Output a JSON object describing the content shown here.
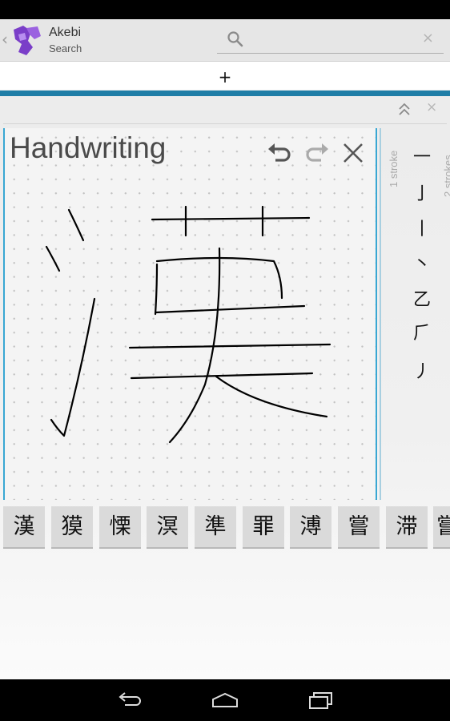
{
  "app": {
    "title": "Akebi",
    "subtitle": "Search"
  },
  "search": {
    "value": "",
    "clear_glyph": "×"
  },
  "tabs": {
    "add_label": "+"
  },
  "panel": {
    "close_glyph": "×"
  },
  "handwriting": {
    "title": "Handwriting"
  },
  "stroke_panel": {
    "groups": [
      {
        "label": "1 stroke"
      },
      {
        "label": "2 strokes"
      }
    ],
    "radicals": [
      "一",
      "亅",
      "丨",
      "丶",
      "乙",
      "⺁",
      "丿"
    ]
  },
  "candidates": [
    "漢",
    "獏",
    "慄",
    "溟",
    "準",
    "罪",
    "溥",
    "嘗",
    "滞",
    "嘗"
  ],
  "colors": {
    "accent": "#1f7ea7",
    "canvas_border": "#39a7d3",
    "logo": "#7a3ec8"
  },
  "icons": {
    "logo": "akebi-logo-icon",
    "search": "search-icon",
    "collapse": "double-chevron-up-icon",
    "undo": "undo-icon",
    "redo": "redo-icon",
    "clear": "clear-icon",
    "back": "back-icon",
    "home": "home-icon",
    "recents": "recents-icon"
  }
}
